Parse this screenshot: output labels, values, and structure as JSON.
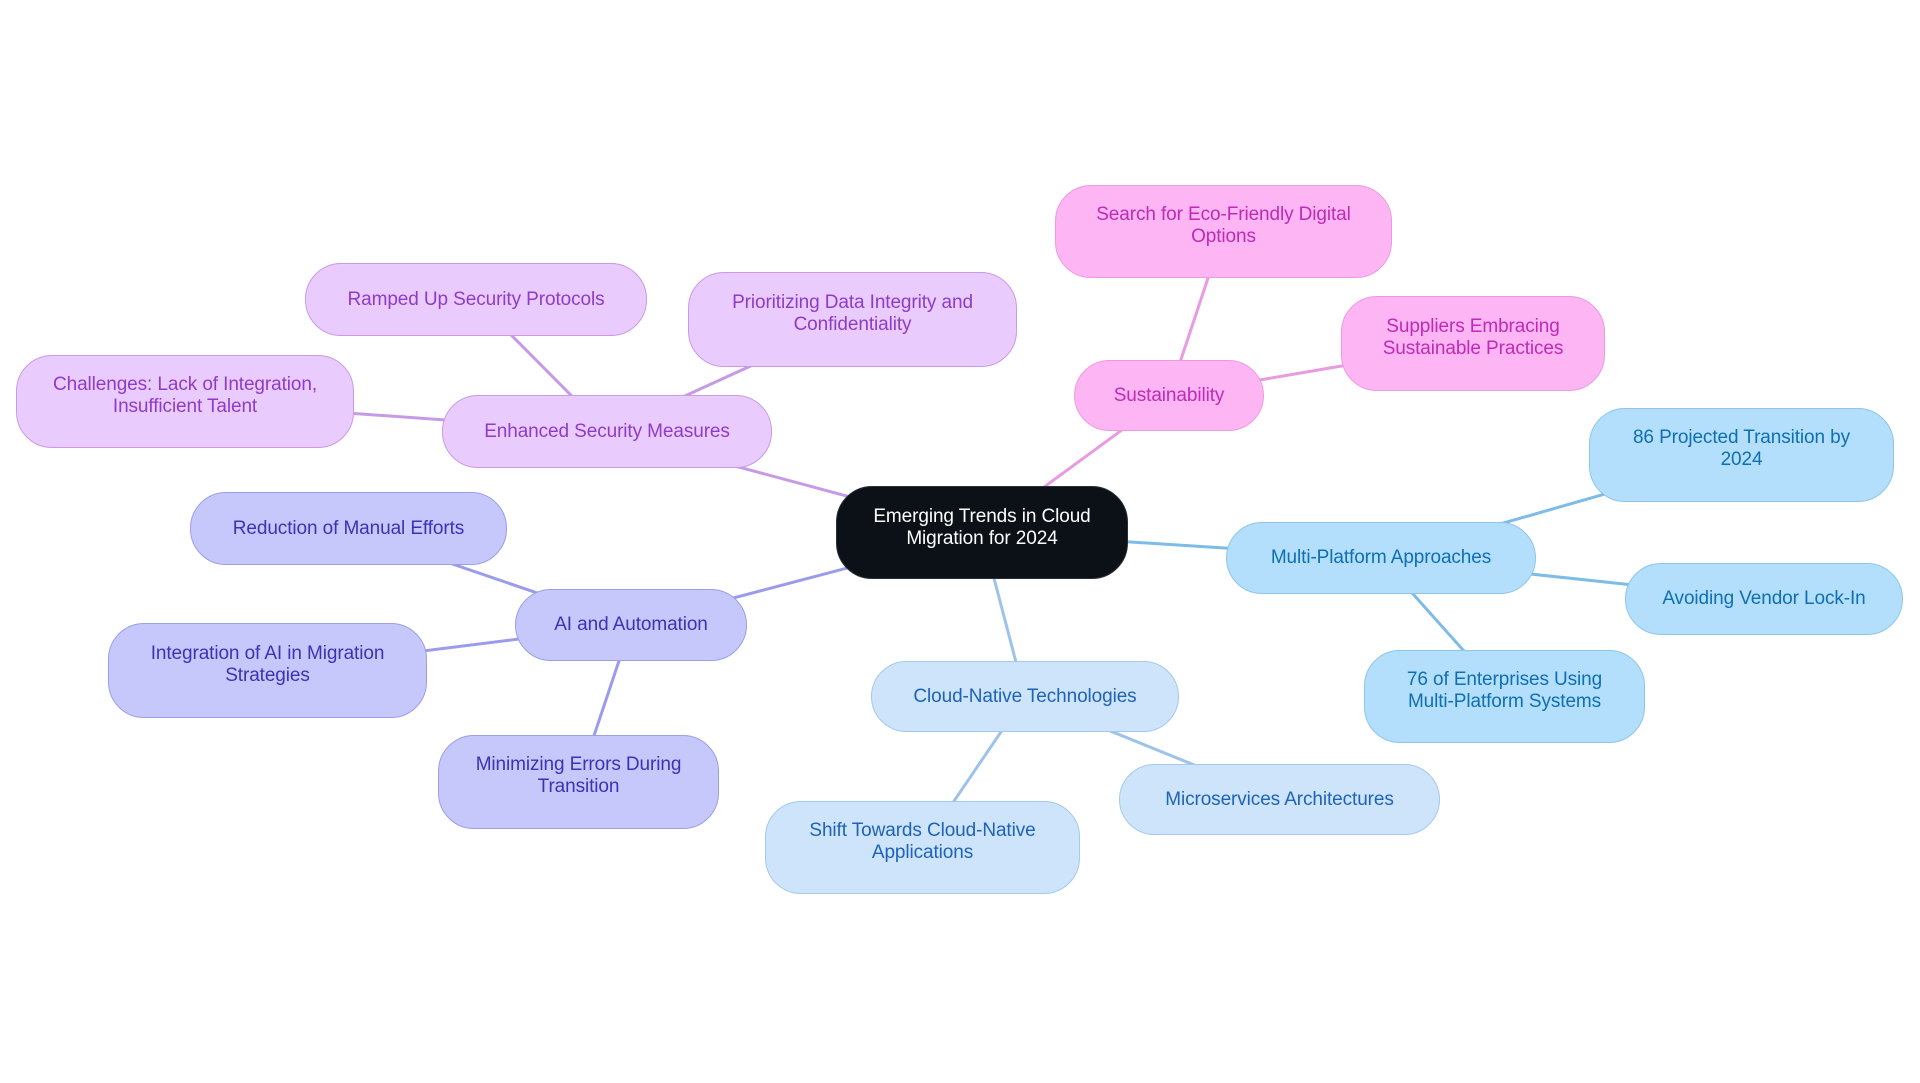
{
  "diagram": {
    "type": "mindmap",
    "root": {
      "id": "root",
      "label": "Emerging Trends in Cloud Migration for 2024"
    },
    "branches": [
      {
        "id": "sec",
        "label": "Enhanced Security Measures",
        "theme": "sec",
        "children": [
          {
            "id": "sec-ramped",
            "label": "Ramped Up Security Protocols"
          },
          {
            "id": "sec-prior",
            "label": "Prioritizing Data Integrity and Confidentiality"
          },
          {
            "id": "sec-chal",
            "label": "Challenges: Lack of Integration, Insufficient Talent"
          }
        ]
      },
      {
        "id": "sus",
        "label": "Sustainability",
        "theme": "sus",
        "children": [
          {
            "id": "sus-eco",
            "label": "Search for Eco-Friendly Digital Options"
          },
          {
            "id": "sus-supp",
            "label": "Suppliers Embracing Sustainable Practices"
          }
        ]
      },
      {
        "id": "mp",
        "label": "Multi-Platform Approaches",
        "theme": "mp",
        "children": [
          {
            "id": "mp-86",
            "label": "86 Projected Transition by 2024"
          },
          {
            "id": "mp-avoid",
            "label": "Avoiding Vendor Lock-In"
          },
          {
            "id": "mp-76",
            "label": "76 of Enterprises Using Multi-Platform Systems"
          }
        ]
      },
      {
        "id": "cn",
        "label": "Cloud-Native Technologies",
        "theme": "cn",
        "children": [
          {
            "id": "cn-micro",
            "label": "Microservices Architectures"
          },
          {
            "id": "cn-shift",
            "label": "Shift Towards Cloud-Native Applications"
          }
        ]
      },
      {
        "id": "ai",
        "label": "AI and Automation",
        "theme": "ai",
        "children": [
          {
            "id": "ai-red",
            "label": "Reduction of Manual Efforts"
          },
          {
            "id": "ai-int",
            "label": "Integration of AI in Migration Strategies"
          },
          {
            "id": "ai-min",
            "label": "Minimizing Errors During Transition"
          }
        ]
      }
    ]
  },
  "labels": {
    "root": "Emerging Trends in Cloud Migration for 2024",
    "sec": "Enhanced Security Measures",
    "sec_ramped": "Ramped Up Security Protocols",
    "sec_prior": "Prioritizing Data Integrity and Confidentiality",
    "sec_chal": "Challenges: Lack of Integration, Insufficient Talent",
    "sus": "Sustainability",
    "sus_eco": "Search for Eco-Friendly Digital Options",
    "sus_supp": "Suppliers Embracing Sustainable Practices",
    "mp": "Multi-Platform Approaches",
    "mp_86": "86 Projected Transition by 2024",
    "mp_avoid": "Avoiding Vendor Lock-In",
    "mp_76": "76 of Enterprises Using Multi-Platform Systems",
    "cn": "Cloud-Native Technologies",
    "cn_micro": "Microservices Architectures",
    "cn_shift": "Shift Towards Cloud-Native Applications",
    "ai": "AI and Automation",
    "ai_red": "Reduction of Manual Efforts",
    "ai_int": "Integration of AI in Migration Strategies",
    "ai_min": "Minimizing Errors During Transition"
  },
  "edges": [
    {
      "from": "root",
      "to": "sec",
      "theme": "sec"
    },
    {
      "from": "sec",
      "to": "sec-ramped",
      "theme": "sec"
    },
    {
      "from": "sec",
      "to": "sec-prior",
      "theme": "sec"
    },
    {
      "from": "sec",
      "to": "sec-chal",
      "theme": "sec"
    },
    {
      "from": "root",
      "to": "sus",
      "theme": "sus"
    },
    {
      "from": "sus",
      "to": "sus-eco",
      "theme": "sus"
    },
    {
      "from": "sus",
      "to": "sus-supp",
      "theme": "sus"
    },
    {
      "from": "root",
      "to": "mp",
      "theme": "mp"
    },
    {
      "from": "mp",
      "to": "mp-86",
      "theme": "mp"
    },
    {
      "from": "mp",
      "to": "mp-avoid",
      "theme": "mp"
    },
    {
      "from": "mp",
      "to": "mp-76",
      "theme": "mp"
    },
    {
      "from": "root",
      "to": "cn",
      "theme": "cn"
    },
    {
      "from": "cn",
      "to": "cn-micro",
      "theme": "cn"
    },
    {
      "from": "cn",
      "to": "cn-shift",
      "theme": "cn"
    },
    {
      "from": "root",
      "to": "ai",
      "theme": "ai"
    },
    {
      "from": "ai",
      "to": "ai-red",
      "theme": "ai"
    },
    {
      "from": "ai",
      "to": "ai-int",
      "theme": "ai"
    },
    {
      "from": "ai",
      "to": "ai-min",
      "theme": "ai"
    }
  ],
  "themes": {
    "root": {
      "fill": "#0c1118",
      "border": "#2a2f36",
      "text": "#ffffff",
      "edge": "#0c1118"
    },
    "sec": {
      "fill": "#eacbfd",
      "border": "#c99ae8",
      "text": "#8e3cc8",
      "edge": "#c69ae6"
    },
    "sus": {
      "fill": "#fdb5f3",
      "border": "#ec9be2",
      "text": "#c02ab7",
      "edge": "#e99ae0"
    },
    "mp": {
      "fill": "#b3dffc",
      "border": "#8ec5ec",
      "text": "#0f6fb3",
      "edge": "#7dbce6"
    },
    "cn": {
      "fill": "#cde4fb",
      "border": "#a4c8ee",
      "text": "#1e63b8",
      "edge": "#9ec3eb"
    },
    "ai": {
      "fill": "#c6c8fc",
      "border": "#9b9ee8",
      "text": "#3b33b5",
      "edge": "#9a9ceb"
    }
  }
}
